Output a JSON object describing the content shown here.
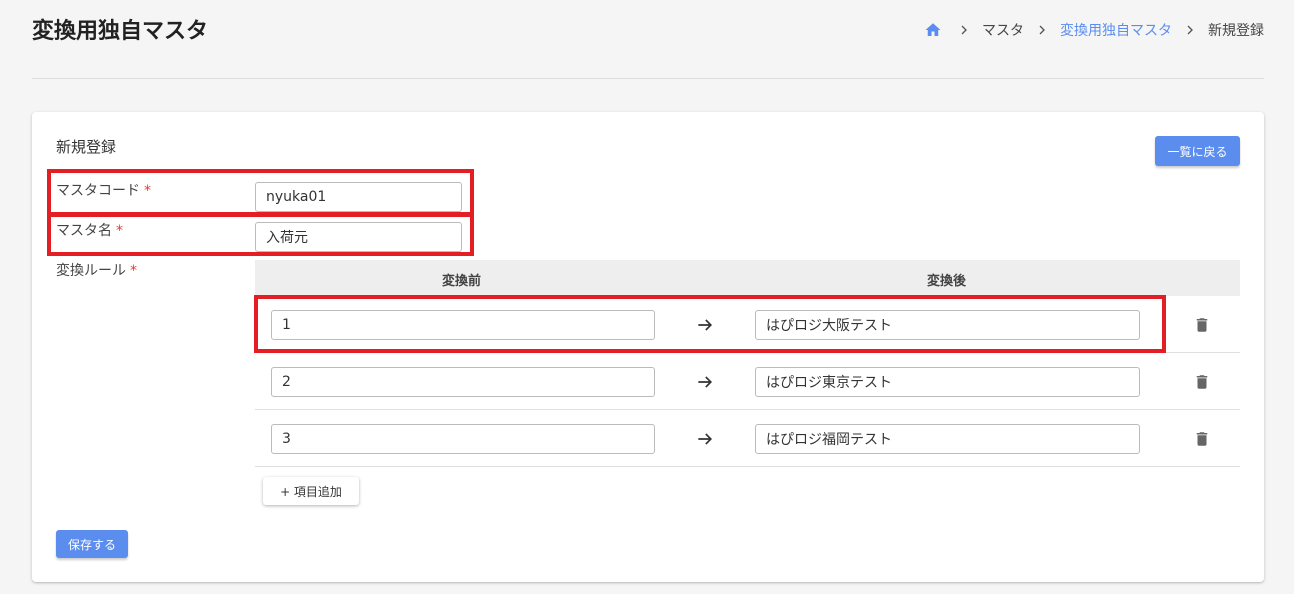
{
  "header": {
    "title": "変換用独自マスタ",
    "breadcrumb": {
      "home_icon": "home-icon",
      "items": [
        "マスタ",
        "変換用独自マスタ",
        "新規登録"
      ]
    }
  },
  "colors": {
    "accent": "#5b8def",
    "required": "#e53935",
    "highlight": "#e31e24"
  },
  "form": {
    "title": "新規登録",
    "back_label": "一覧に戻る",
    "required_mark": "*",
    "master_code": {
      "label": "マスタコード",
      "value": "nyuka01"
    },
    "master_name": {
      "label": "マスタ名",
      "value": "入荷元"
    },
    "rules": {
      "label": "変換ルール",
      "col_before": "変換前",
      "col_after": "変換後",
      "rows": [
        {
          "before": "1",
          "after": "はぴロジ大阪テスト"
        },
        {
          "before": "2",
          "after": "はぴロジ東京テスト"
        },
        {
          "before": "3",
          "after": "はぴロジ福岡テスト"
        }
      ],
      "add_label": "+ 項目追加"
    },
    "save_label": "保存する"
  }
}
